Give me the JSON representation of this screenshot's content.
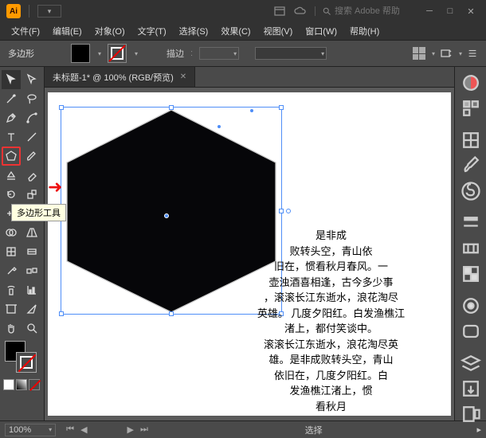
{
  "app": {
    "logo_text": "Ai"
  },
  "title": {
    "search_placeholder": "搜索 Adobe 帮助"
  },
  "menus": [
    "文件(F)",
    "编辑(E)",
    "对象(O)",
    "文字(T)",
    "选择(S)",
    "效果(C)",
    "视图(V)",
    "窗口(W)",
    "帮助(H)"
  ],
  "control": {
    "shape": "多边形",
    "stroke_label": "描边",
    "stroke_dd": ""
  },
  "tab": {
    "label": "未标题-1* @ 100% (RGB/预览)"
  },
  "tooltip": {
    "polygon": "多边形工具"
  },
  "body_text": "是非成\n败转头空，青山依\n旧在，惯看秋月春风。一\n壶浊酒喜相逢，古今多少事\n，滚滚长江东逝水，浪花淘尽\n英雄。 几度夕阳红。白发渔樵江\n渚上，都付笑谈中。\n滚滚长江东逝水，浪花淘尽英\n雄。是非成败转头空，青山\n依旧在，几度夕阳红。白\n发渔樵江渚上，惯\n看秋月",
  "status": {
    "zoom": "100%",
    "mode": "选择"
  }
}
